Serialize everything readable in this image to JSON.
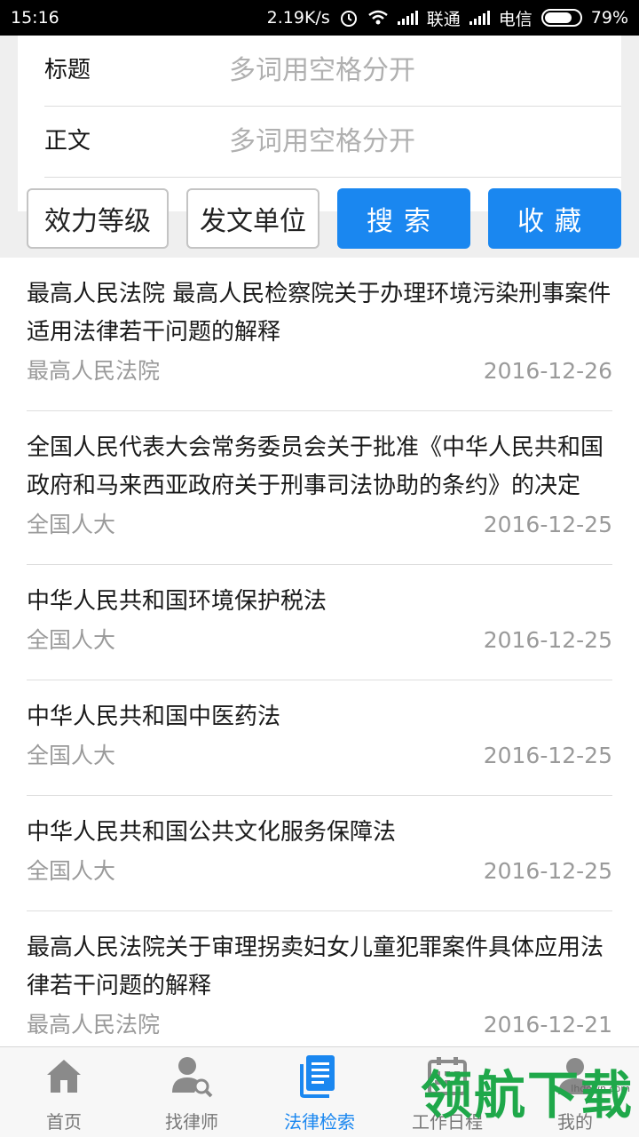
{
  "statusbar": {
    "time": "15:16",
    "speed": "2.19K/s",
    "carrier1": "联通",
    "carrier2": "电信",
    "battery": "79%",
    "battery_level": 0.79
  },
  "search": {
    "title_label": "标题",
    "title_placeholder": "多词用空格分开",
    "body_label": "正文",
    "body_placeholder": "多词用空格分开",
    "buttons": {
      "level": "效力等级",
      "issuer": "发文单位",
      "search": "搜索",
      "favorite": "收藏"
    }
  },
  "results": [
    {
      "title": "最高人民法院 最高人民检察院关于办理环境污染刑事案件适用法律若干问题的解释",
      "source": "最高人民法院",
      "date": "2016-12-26"
    },
    {
      "title": "全国人民代表大会常务委员会关于批准《中华人民共和国政府和马来西亚政府关于刑事司法协助的条约》的决定",
      "source": "全国人大",
      "date": "2016-12-25"
    },
    {
      "title": "中华人民共和国环境保护税法",
      "source": "全国人大",
      "date": "2016-12-25"
    },
    {
      "title": "中华人民共和国中医药法",
      "source": "全国人大",
      "date": "2016-12-25"
    },
    {
      "title": "中华人民共和国公共文化服务保障法",
      "source": "全国人大",
      "date": "2016-12-25"
    },
    {
      "title": "最高人民法院关于审理拐卖妇女儿童犯罪案件具体应用法律若干问题的解释",
      "source": "最高人民法院",
      "date": "2016-12-21"
    }
  ],
  "tabbar": {
    "tabs": [
      {
        "label": "首页",
        "icon": "home-icon"
      },
      {
        "label": "找律师",
        "icon": "lawyer-search-icon"
      },
      {
        "label": "法律检索",
        "icon": "document-icon"
      },
      {
        "label": "工作日程",
        "icon": "calendar-icon"
      },
      {
        "label": "我的",
        "icon": "person-icon"
      }
    ],
    "active_index": 2
  },
  "watermark": {
    "text": "领航下载",
    "url": "lhdown.com"
  },
  "colors": {
    "accent": "#1a87f0",
    "muted": "#9a9a9a"
  }
}
